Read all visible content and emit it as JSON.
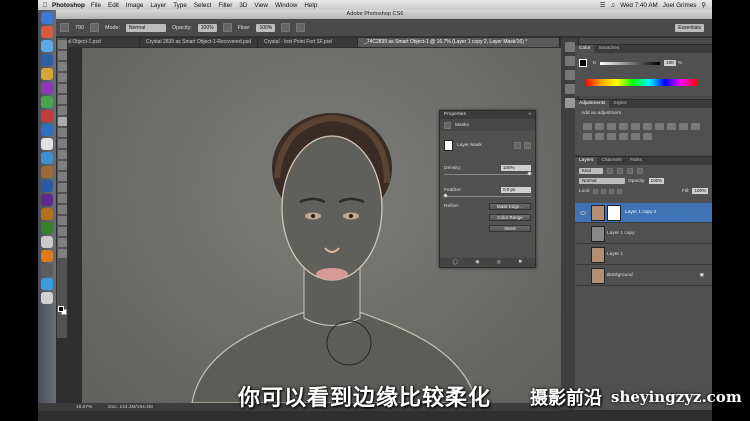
{
  "menubar": {
    "app": "Photoshop",
    "items": [
      "File",
      "Edit",
      "Image",
      "Layer",
      "Type",
      "Select",
      "Filter",
      "3D",
      "View",
      "Window",
      "Help"
    ],
    "clock": "Wed 7:40 AM",
    "user": "Joel Grimes"
  },
  "window": {
    "title": "Adobe Photoshop CS6"
  },
  "options": {
    "brush_size": "790",
    "mode_label": "Mode:",
    "mode_value": "Normal",
    "opacity_label": "Opacity:",
    "opacity_value": "100%",
    "flow_label": "Flow:",
    "flow_value": "100%",
    "workspace": "Essentials"
  },
  "tabs": [
    {
      "label": "ial Object-1.psd"
    },
    {
      "label": "Crystal 2839 as Smart Object-1-Recovered.psd"
    },
    {
      "label": "Crystal - Inst Point Fort SF.psd"
    },
    {
      "label": "_74C2839 as Smart Object-1 @ 16.7% (Layer 1 copy 2, Layer Mask/16) *"
    }
  ],
  "status": {
    "zoom": "16.67%",
    "doc": "Doc: 144.2M/194.4M"
  },
  "properties": {
    "title": "Properties",
    "section": "Masks",
    "mask_label": "Layer Mask",
    "density_label": "Density:",
    "density_value": "100%",
    "feather_label": "Feather:",
    "feather_value": "0.0 px",
    "refine_label": "Refine:",
    "mask_edge_btn": "Mask Edge...",
    "color_range_btn": "Color Range",
    "invert_btn": "Invert"
  },
  "color_panel": {
    "tabs": [
      "Color",
      "Swatches"
    ],
    "k_label": "K",
    "k_value": "100",
    "k_unit": "%"
  },
  "adjustments": {
    "tabs": [
      "Adjustments",
      "Styles"
    ],
    "heading": "Add an adjustment"
  },
  "layers_panel": {
    "tabs": [
      "Layers",
      "Channels",
      "Paths"
    ],
    "kind_label": "Kind",
    "blend": "Normal",
    "opacity_label": "Opacity:",
    "opacity_value": "100%",
    "lock_label": "Lock:",
    "fill_label": "Fill:",
    "fill_value": "100%",
    "layers": [
      {
        "name": "Layer 1 copy 2",
        "selected": true
      },
      {
        "name": "Layer 1 copy",
        "selected": false
      },
      {
        "name": "Layer 1",
        "selected": false
      },
      {
        "name": "Background",
        "selected": false
      }
    ]
  },
  "subtitle": "你可以看到边缘比较柔化",
  "watermark": {
    "brand": "摄影前沿",
    "url": "sheyingzyz.com"
  }
}
